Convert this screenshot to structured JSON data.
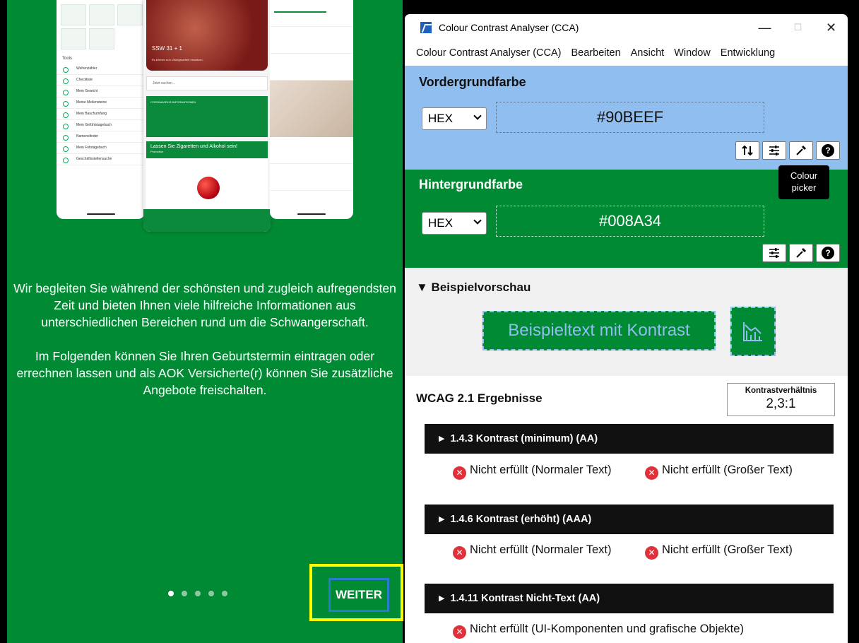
{
  "app": {
    "intro_p1": "Wir begleiten Sie während der schönsten und zugleich aufregendsten Zeit und bieten Ihnen viele hilfreiche Informationen aus unterschiedlichen Bereichen rund um die Schwangerschaft.",
    "intro_p2": "Im Folgenden können Sie Ihren Geburtstermin eintragen oder errechnen lassen und als AOK Versicherte(r) können Sie zusätzliche Angebote freischalten.",
    "next_button": "WEITER",
    "pagination": {
      "total": 5,
      "current": 1
    },
    "background_color": "#008A34",
    "highlight_color": "#ffff00",
    "screens": {
      "tools_heading": "Tools",
      "tools": [
        "Wehenzähler",
        "Checkliste",
        "Mein Gewicht",
        "Meine Meilensteine",
        "Mein Bauchumfang",
        "Mein Gefühlstagebuch",
        "Namensfinder",
        "Mein Fototagebuch",
        "Geschäftsstellensuche"
      ],
      "ssw": "SSW 31 + 1",
      "ssw_sub": "Es können nun Übungswehen einsetzen.",
      "search": "Jetzt suchen...",
      "corona_title": "CORONAVIRUS-INFORMATIONEN",
      "promo_title": "Lassen Sie Zigaretten und Alkohol sein!",
      "promo_sub": "Promotion"
    }
  },
  "cca": {
    "title": "Colour Contrast Analyser (CCA)",
    "menu": [
      "Colour Contrast Analyser (CCA)",
      "Bearbeiten",
      "Ansicht",
      "Window",
      "Entwicklung"
    ],
    "foreground": {
      "title": "Vordergrundfarbe",
      "format": "HEX",
      "value": "#90BEEF",
      "color": "#90BEEF"
    },
    "background": {
      "title": "Hintergrundfarbe",
      "format": "HEX",
      "value": "#008A34",
      "color": "#008A34"
    },
    "tooltip": [
      "Colour",
      "picker"
    ],
    "preview": {
      "title": "▼ Beispielvorschau",
      "sample_text": "Beispieltext mit Kontrast"
    },
    "wcag": {
      "title": "WCAG 2.1 Ergebnisse",
      "ratio_label": "Kontrastverhältnis",
      "ratio_value": "2,3:1",
      "criteria": [
        {
          "title": "1.4.3 Kontrast (minimum) (AA)",
          "results": [
            "Nicht erfüllt (Normaler Text)",
            "Nicht erfüllt (Großer Text)"
          ]
        },
        {
          "title": "1.4.6 Kontrast (erhöht) (AAA)",
          "results": [
            "Nicht erfüllt (Normaler Text)",
            "Nicht erfüllt (Großer Text)"
          ]
        },
        {
          "title": "1.4.11 Kontrast Nicht-Text (AA)",
          "results": [
            "Nicht erfüllt (UI-Komponenten und grafische Objekte)"
          ]
        }
      ]
    }
  }
}
